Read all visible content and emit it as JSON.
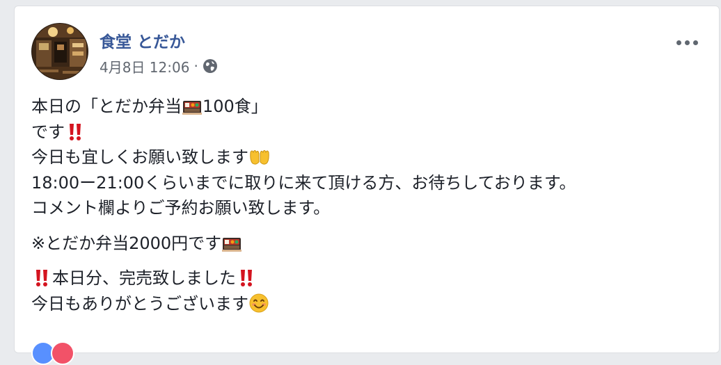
{
  "post": {
    "author": "食堂 とだか",
    "timestamp": "4月8日 12:06",
    "separator": "·",
    "privacy_icon": "globe-icon",
    "more_icon": "more-options-icon",
    "avatar_icon": "restaurant-interior-photo",
    "body": {
      "p1_l1_a": "本日の「とだか弁当",
      "p1_l1_b": "100食」",
      "p1_l2": "です",
      "p1_l3": "今日も宜しくお願い致します",
      "p1_l4": "18:00ー21:00くらいまでに取りに来て頂ける方、お待ちしております。",
      "p1_l5": "コメント欄よりご予約お願い致します。",
      "p2_l1": "※とだか弁当2000円です",
      "p3_l1": "本日分、完売致しました",
      "p3_l2": "今日もありがとうございます"
    },
    "emoji_names": [
      "bento-box-icon",
      "double-exclamation-icon",
      "palms-up-together-icon",
      "smiling-face-icon"
    ],
    "reactions": [
      "like-reaction-icon",
      "love-reaction-icon"
    ]
  },
  "colors": {
    "author": "#385898",
    "meta": "#616770",
    "text": "#1d2129",
    "exclamation": "#d4141f",
    "background": "#e9ebee",
    "card": "#ffffff"
  }
}
